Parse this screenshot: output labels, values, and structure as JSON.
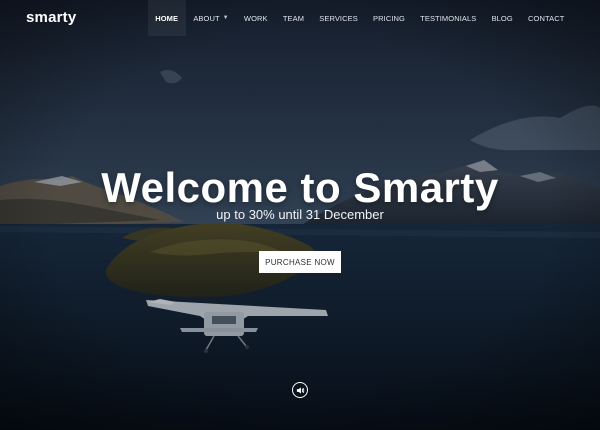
{
  "brand": {
    "logo_text": "smarty"
  },
  "nav": {
    "items": [
      {
        "label": "HOME",
        "active": true
      },
      {
        "label": "ABOUT",
        "has_dropdown": true
      },
      {
        "label": "WORK"
      },
      {
        "label": "TEAM"
      },
      {
        "label": "SERVICES"
      },
      {
        "label": "PRICING"
      },
      {
        "label": "TESTIMONIALS"
      },
      {
        "label": "BLOG"
      },
      {
        "label": "CONTACT"
      }
    ]
  },
  "hero": {
    "title": "Welcome to Smarty",
    "subtitle": "up to 30% until 31 December",
    "cta_label": "PURCHASE NOW",
    "sound_icon": "speaker-icon"
  },
  "colors": {
    "text": "#ffffff",
    "button_bg": "#ffffff",
    "button_text": "#2b2f35"
  }
}
